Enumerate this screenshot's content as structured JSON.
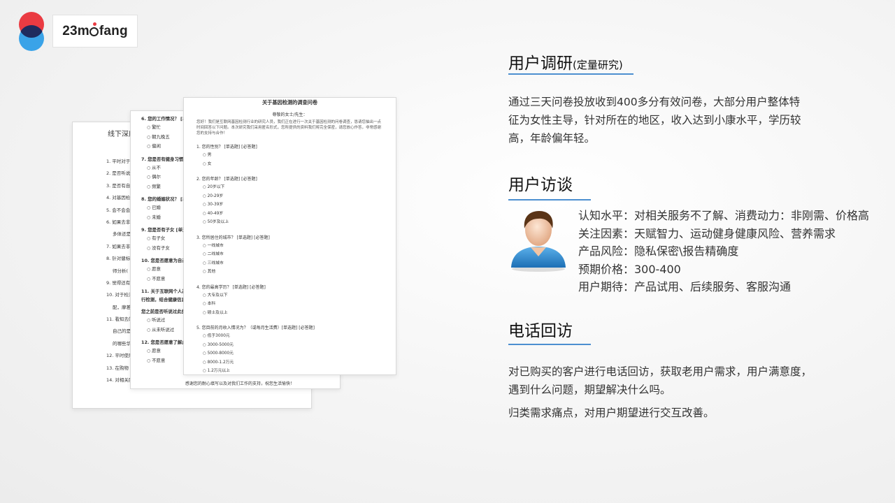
{
  "logo": {
    "text_before": "23m",
    "text_after": "fang",
    "colors": {
      "top_circle": "#ea3b42",
      "bottom_circle": "#3aa3e8",
      "overlap": "#1f2b5e"
    }
  },
  "papers": {
    "back": {
      "title": "线下深度",
      "rows": [
        "1.  平时对于",
        "2.  是否听说",
        "3.  是否有自",
        "4.  对基因检",
        "5.  会不会会",
        "6.  如果去非",
        "     多体还是",
        "7.  如果去非",
        "8.  针对健标",
        "     师分析(",
        "9.  觉得还有",
        "10. 对于检测",
        "     配，摩差",
        "11. 看知去的",
        "     自己的是",
        "     的哪些华",
        "12. 平时使用",
        "13. 在购物",
        "14. 对相关服务还有什么自己的建议或者个人见解？"
      ]
    },
    "middle": {
      "items": [
        {
          "q": "6. 您的工作情况？ [单选",
          "opts": [
            "繁忙",
            "朝九晚五",
            "偏闲"
          ]
        },
        {
          "q": "7. 您是否有健身习惯？",
          "opts": [
            "从不",
            "偶尔",
            "频繁"
          ]
        },
        {
          "q": "8. 您的婚姻状况？ [单选",
          "opts": [
            "已婚",
            "未婚"
          ]
        },
        {
          "q": "9. 您是否有子女 [单选题",
          "opts": [
            "有子女",
            "没有子女"
          ]
        },
        {
          "q": "10. 您是否愿意为自己和",
          "opts": [
            "愿意",
            "不愿意"
          ]
        },
        {
          "q": "11. 关于互联网个人基因检测服务，用户可以通过在线订购检测盒，通过邮寄检测样本到医院进行检测，结合健康信息等，您可及格进行健康风险评估。您对此服务是否了解？",
          "opts": []
        },
        {
          "q": "您之前是否听说过此类服务？",
          "opts": [
            "听说过",
            "从未听说过"
          ]
        },
        {
          "q": "12. 您是否愿意了解此服务",
          "opts": [
            "愿意",
            "不愿意"
          ]
        }
      ],
      "footer": "感谢您的耐心填写以及对我们工作的支持，祝您生活愉快！"
    },
    "front": {
      "title": "关于基因检测的调查问卷",
      "greeting_center": "尊敬的女士/先生：",
      "greeting": "您好！我们是互联网基因检测行业的研究人员，我们正在进行一次关于基因检测的问卷调查，恳请您抽出一点时间回答以下问题。本次研究我们采用匿名形式，您所提供的资料我们将完全保密，请您放心作答，非常感谢您的支持与合作！",
      "questions": [
        {
          "q": "1. 您的性别？ [单选题] [必答题]",
          "opts": [
            "男",
            "女"
          ]
        },
        {
          "q": "2. 您的年龄？ [单选题] [必答题]",
          "opts": [
            "20岁以下",
            "20-29岁",
            "30-39岁",
            "40-49岁",
            "50岁及以上"
          ]
        },
        {
          "q": "3. 您所居住的城市？ [单选题] [必答题]",
          "opts": [
            "一线城市",
            "二线城市",
            "三线城市",
            "其他"
          ]
        },
        {
          "q": "4. 您的最高学历？ [单选题] [必答题]",
          "opts": [
            "大专及以下",
            "本科",
            "硕士及以上"
          ]
        },
        {
          "q": "5. 您目前的月收入情况为？（或每月生活费）[单选题] [必答题]",
          "opts": [
            "低于3000元",
            "3000-5000元",
            "5000-8000元",
            "8000-1.2万元",
            "1.2万元以上"
          ]
        }
      ]
    }
  },
  "sections": {
    "research": {
      "title": "用户调研",
      "title_small": "(定量研究)",
      "lines": [
        "通过三天问卷投放收到400多分有效问卷，大部分用户整体特",
        "征为女性主导，针对所在的地区，收入达到小康水平，学历较",
        "高，年龄偏年轻。"
      ]
    },
    "interview": {
      "title": "用户访谈",
      "items": [
        "认知水平：对相关服务不了解、消费动力：非刚需、价格高",
        "关注因素：天赋智力、运动健身健康风险、营养需求",
        "产品风险：隐私保密\\报告精确度",
        "预期价格：300-400",
        "用户期待：产品试用、后续服务、客服沟通"
      ]
    },
    "phone": {
      "title": "电话回访",
      "lines": [
        "对已购买的客户进行电话回访，获取老用户需求，用户满意度，",
        "遇到什么问题，期望解决什么吗。"
      ],
      "line_extra": "归类需求痛点，对用户期望进行交互改善。"
    }
  },
  "accent_color": "#4c8fd0"
}
